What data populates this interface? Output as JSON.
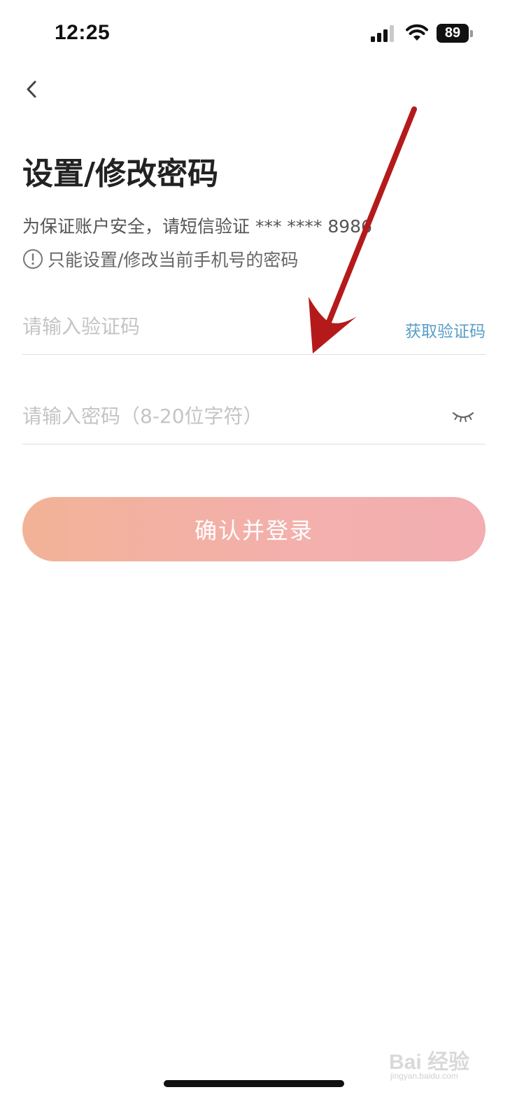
{
  "status_bar": {
    "time": "12:25",
    "battery_level": "89"
  },
  "page": {
    "title": "设置/修改密码",
    "subtitle": "为保证账户安全，请短信验证 *** **** 8986",
    "notice": "只能设置/修改当前手机号的密码"
  },
  "form": {
    "code_placeholder": "请输入验证码",
    "get_code_label": "获取验证码",
    "password_placeholder": "请输入密码（8-20位字符）",
    "submit_label": "确认并登录"
  },
  "watermark": {
    "text": "Bai 经验",
    "subtext": "jingyan.baidu.com"
  },
  "colors": {
    "accent_link": "#5a9ec9",
    "button_gradient_start": "#f2b297",
    "button_gradient_end": "#f2aeb0",
    "annotation_arrow": "#b51a1a"
  },
  "icons": {
    "back": "chevron-left-icon",
    "notice": "exclamation-circle-icon",
    "password_visibility": "eye-closed-icon",
    "signal": "cellular-signal-icon",
    "wifi": "wifi-icon",
    "battery": "battery-icon"
  }
}
